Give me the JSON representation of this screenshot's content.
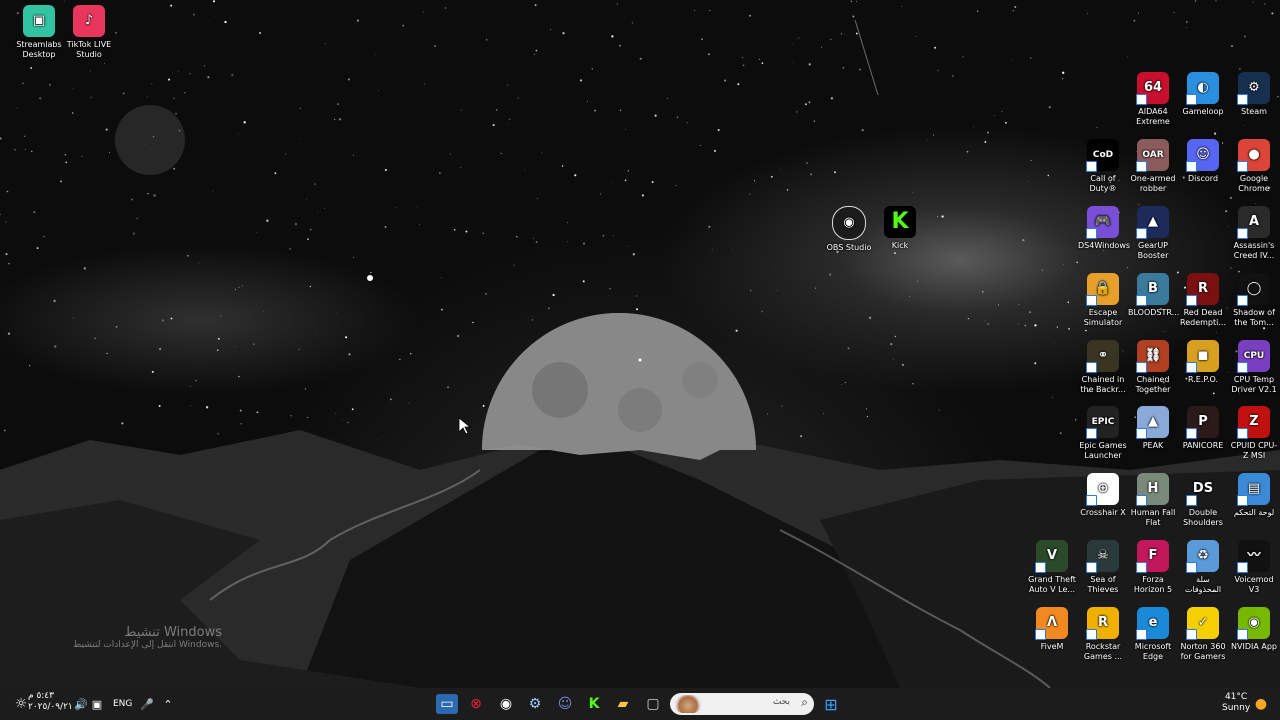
{
  "desktop_left": [
    {
      "label": "Streamlabs Desktop",
      "name": "streamlabs-desktop-icon",
      "color": "#31c3a2",
      "glyph": "▣"
    },
    {
      "label": "TikTok LIVE Studio",
      "name": "tiktok-live-studio-icon",
      "color": "#e8365d",
      "glyph": "♪"
    }
  ],
  "desktop_middle": [
    {
      "label": "OBS Studio",
      "name": "obs-studio-icon",
      "color": "#1b1b1b",
      "glyph": "◉"
    },
    {
      "label": "Kick",
      "name": "kick-icon",
      "color": "#000000",
      "glyph": "K"
    }
  ],
  "desktop_grid": [
    {
      "label": "AIDA64 Extreme",
      "name": "aida64-icon",
      "color": "#c8102e",
      "glyph": "64"
    },
    {
      "label": "Gameloop",
      "name": "gameloop-icon",
      "color": "#2b8fe0",
      "glyph": "◐"
    },
    {
      "label": "Steam",
      "name": "steam-icon",
      "color": "#17304f",
      "glyph": "⚙"
    },
    {
      "label": "Call of Duty®",
      "name": "call-of-duty-icon",
      "color": "#000000",
      "glyph": "CoD"
    },
    {
      "label": "One-armed robber",
      "name": "one-armed-robber-icon",
      "color": "#8b5a5a",
      "glyph": "OAR"
    },
    {
      "label": "Discord",
      "name": "discord-icon",
      "color": "#5865f2",
      "glyph": "☺"
    },
    {
      "label": "Google Chrome",
      "name": "google-chrome-icon",
      "color": "#db4437",
      "glyph": "●"
    },
    {
      "label": "DS4Windows",
      "name": "ds4windows-icon",
      "color": "#7a4fd8",
      "glyph": "🎮"
    },
    {
      "label": "GearUP Booster",
      "name": "gearup-booster-icon",
      "color": "#1e2a5a",
      "glyph": "▲"
    },
    {
      "label": "Assassin's Creed IV...",
      "name": "assassins-creed-icon",
      "color": "#2a2a2a",
      "glyph": "A"
    },
    {
      "label": "Escape Simulator",
      "name": "escape-simulator-icon",
      "color": "#e6a02a",
      "glyph": "🔒"
    },
    {
      "label": "BLOODSTR...",
      "name": "bloodstrike-icon",
      "color": "#3a7a9a",
      "glyph": "B"
    },
    {
      "label": "Red Dead Redempti...",
      "name": "red-dead-redemption-icon",
      "color": "#7a1010",
      "glyph": "R"
    },
    {
      "label": "Shadow of the Tom...",
      "name": "shadow-of-the-tomb-raider-icon",
      "color": "#111111",
      "glyph": "◯"
    },
    {
      "label": "Chained in the Backr...",
      "name": "chained-in-the-backrooms-icon",
      "color": "#3a3520",
      "glyph": "⚭"
    },
    {
      "label": "Chained Together",
      "name": "chained-together-icon",
      "color": "#b04020",
      "glyph": "⛓"
    },
    {
      "label": "R.E.P.O.",
      "name": "repo-icon",
      "color": "#d8a020",
      "glyph": "◼"
    },
    {
      "label": "CPU Temp Driver V2.1",
      "name": "cpu-temp-driver-icon",
      "color": "#7a3fc0",
      "glyph": "CPU"
    },
    {
      "label": "Epic Games Launcher",
      "name": "epic-games-launcher-icon",
      "color": "#222222",
      "glyph": "EPIC"
    },
    {
      "label": "PEAK",
      "name": "peak-icon",
      "color": "#8aa8d8",
      "glyph": "▲"
    },
    {
      "label": "PANICORE",
      "name": "panicore-icon",
      "color": "#2a1a1a",
      "glyph": "P"
    },
    {
      "label": "CPUID CPU-Z MSI",
      "name": "cpu-z-msi-icon",
      "color": "#c01010",
      "glyph": "Z"
    },
    {
      "label": "Crosshair X",
      "name": "crosshair-x-icon",
      "color": "#ffffff",
      "glyph": "⊕"
    },
    {
      "label": "Human Fall Flat",
      "name": "human-fall-flat-icon",
      "color": "#7a8a7a",
      "glyph": "H"
    },
    {
      "label": "Double Shoulders",
      "name": "double-shoulders-icon",
      "color": "#1a1a1a",
      "glyph": "DS"
    },
    {
      "label": "لوحة التحكم",
      "name": "control-panel-icon",
      "color": "#3a8ad8",
      "glyph": "▤"
    },
    {
      "label": "Grand Theft Auto V Le...",
      "name": "gta-v-icon",
      "color": "#2a4a2a",
      "glyph": "V"
    },
    {
      "label": "Sea of Thieves",
      "name": "sea-of-thieves-icon",
      "color": "#2a3a3a",
      "glyph": "☠"
    },
    {
      "label": "Forza Horizon 5",
      "name": "forza-horizon-5-icon",
      "color": "#c2185b",
      "glyph": "F"
    },
    {
      "label": "سلة المحذوفات",
      "name": "recycle-bin-icon",
      "color": "#5a9ad8",
      "glyph": "♻"
    },
    {
      "label": "FiveM",
      "name": "fivem-icon",
      "color": "#f08a20",
      "glyph": "Λ"
    },
    {
      "label": "Rockstar Games ...",
      "name": "rockstar-games-icon",
      "color": "#f0b000",
      "glyph": "R"
    },
    {
      "label": "Microsoft Edge",
      "name": "microsoft-edge-icon",
      "color": "#1a8ad8",
      "glyph": "e"
    },
    {
      "label": "Norton 360 for Gamers",
      "name": "norton-360-icon",
      "color": "#f5d000",
      "glyph": "✓"
    },
    {
      "label": "Voicemod V3",
      "name": "voicemod-icon",
      "color": "#111111",
      "glyph": "〰"
    },
    {
      "label": "NVIDIA App",
      "name": "nvidia-app-icon",
      "color": "#76b900",
      "glyph": "◉"
    }
  ],
  "watermark": {
    "line1": "تنشيط Windows",
    "line2": "انتقل إلى الإعدادات لتنشيط Windows."
  },
  "taskbar": {
    "search_placeholder": "بحث",
    "language": "ENG",
    "weather_temp": "41°C",
    "weather_text": "Sunny",
    "clock_time": "٥:٤٣ م",
    "clock_date": "٢٠٢٥/٠٩/٢١"
  }
}
